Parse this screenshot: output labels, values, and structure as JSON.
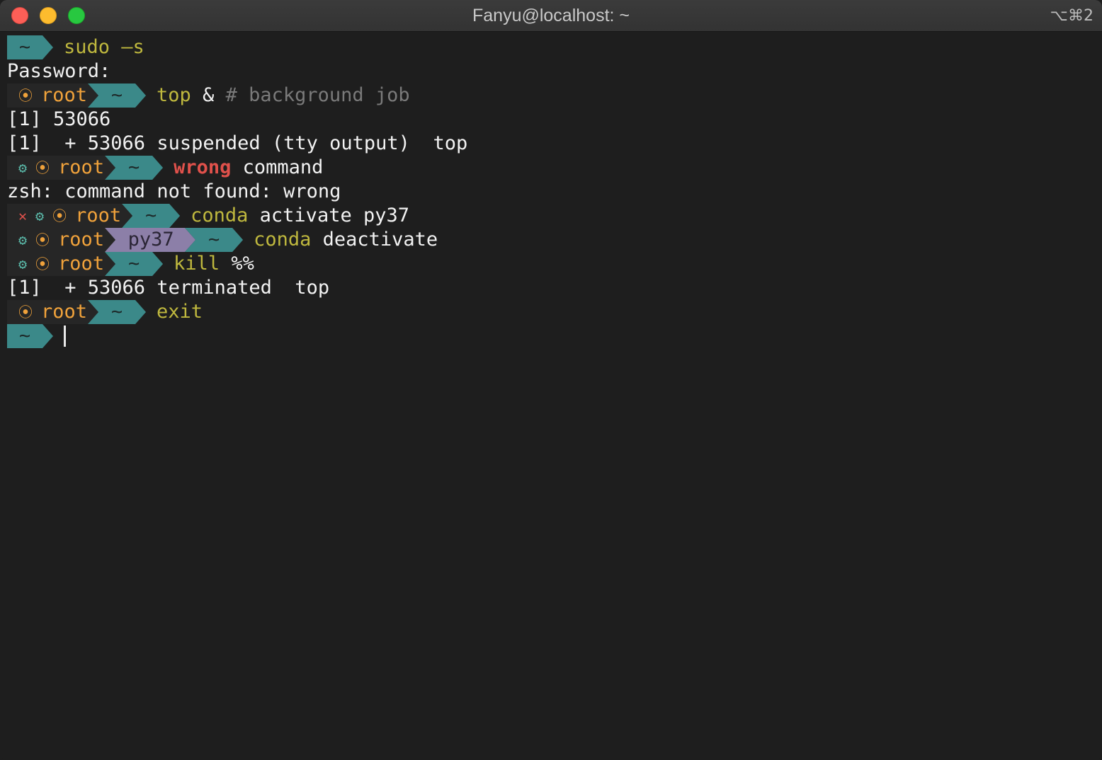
{
  "window": {
    "title": "Fanyu@localhost: ~",
    "shortcut": "⌥⌘2",
    "colors": {
      "background": "#1e1e1e",
      "dir_segment": "#3b8989",
      "env_segment": "#8c7fa8",
      "command": "#bfb83e",
      "error": "#e0514b",
      "user": "#f0a23b"
    }
  },
  "terminal": {
    "l1": {
      "dir": "~",
      "cmd": "sudo",
      "args": " –s"
    },
    "l2": {
      "text": "Password:"
    },
    "l3": {
      "indicator": "⦿",
      "user": "root",
      "dir": "~",
      "cmd": "top",
      "args": " & ",
      "comment": "# background job"
    },
    "l4": {
      "text": "[1] 53066"
    },
    "l5": {
      "text": "[1]  + 53066 suspended (tty output)  top"
    },
    "l6": {
      "gear": "⚙",
      "indicator": "⦿",
      "user": "root",
      "dir": "~",
      "cmd": "wrong",
      "args": " command"
    },
    "l7": {
      "text": "zsh: command not found: wrong"
    },
    "l8": {
      "error": "✕",
      "gear": "⚙",
      "indicator": "⦿",
      "user": "root",
      "dir": "~",
      "cmd": "conda",
      "args": " activate py37"
    },
    "l9": {
      "gear": "⚙",
      "indicator": "⦿",
      "user": "root",
      "env": "py37",
      "dir": "~",
      "cmd": "conda",
      "args": " deactivate"
    },
    "l10": {
      "gear": "⚙",
      "indicator": "⦿",
      "user": "root",
      "dir": "~",
      "cmd": "kill",
      "args": " %%"
    },
    "l11": {
      "text": "[1]  + 53066 terminated  top"
    },
    "l12": {
      "indicator": "⦿",
      "user": "root",
      "dir": "~",
      "cmd": "exit"
    },
    "l13": {
      "dir": "~"
    }
  }
}
